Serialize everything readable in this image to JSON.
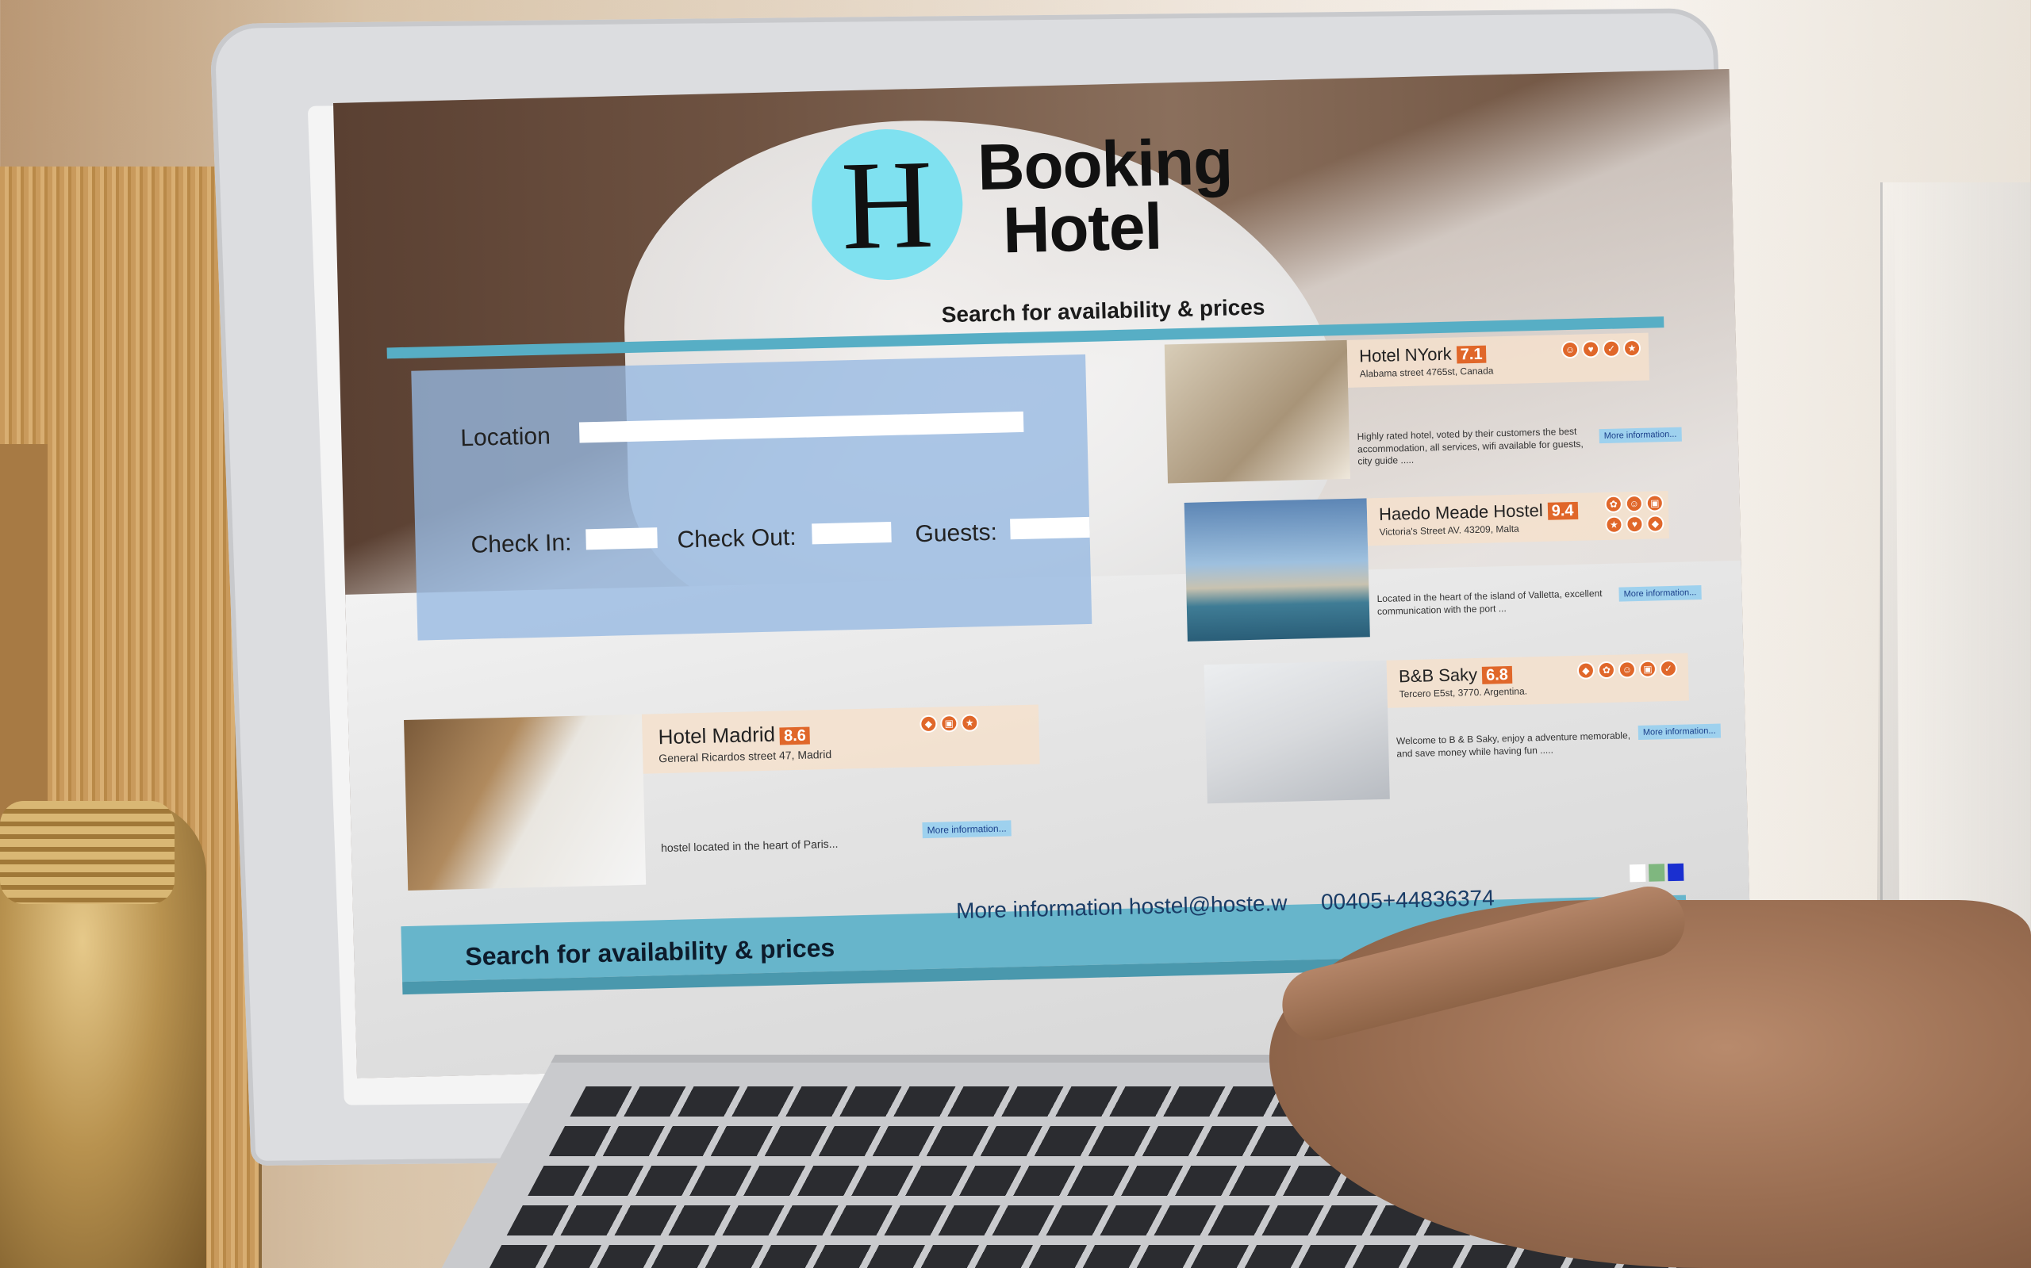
{
  "brand": {
    "logo_letter": "H",
    "name_line1": "Booking",
    "name_line2": "Hotel",
    "tagline": "Search for availability & prices"
  },
  "search": {
    "location_label": "Location",
    "checkin_label": "Check In:",
    "checkout_label": "Check Out:",
    "guests_label": "Guests:"
  },
  "hotels": [
    {
      "name": "Hotel NYork",
      "rating": "7.1",
      "address": "Alabama street 4765st, Canada",
      "description": "Highly rated hotel, voted by their customers the best accommodation, all services, wifi available for guests, city guide .....",
      "more": "More information...",
      "amenities": [
        "smile-icon",
        "heart-icon",
        "check-icon",
        "star-icon"
      ]
    },
    {
      "name": "Haedo Meade Hostel",
      "rating": "9.4",
      "address": "Victoria's Street AV. 43209, Malta",
      "description": "Located in the heart of the island of Valletta, excellent communication with the port ...",
      "more": "More information...",
      "amenities": [
        "paw-icon",
        "smile-icon",
        "tv-icon",
        "star-icon",
        "heart-icon",
        "shield-icon"
      ]
    },
    {
      "name": "B&B Saky",
      "rating": "6.8",
      "address": "Tercero E5st, 3770. Argentina.",
      "description": "Welcome to B & B Saky, enjoy a adventure memorable, and save money while having fun .....",
      "more": "More information...",
      "amenities": [
        "shield-icon",
        "paw-icon",
        "smile-icon",
        "tv-icon",
        "check-icon"
      ]
    },
    {
      "name": "Hotel Madrid",
      "rating": "8.6",
      "address": "General Ricardos street 47, Madrid",
      "description": "hostel located in the heart of Paris...",
      "more": "More information...",
      "amenities": [
        "shield-icon",
        "tv-icon",
        "star-icon"
      ]
    }
  ],
  "footer": {
    "tagline": "Search for availability & prices",
    "email": "More information hostel@hoste.w",
    "phone": "00405+44836374"
  },
  "colors": {
    "accent": "#57aec5",
    "logo": "#7fe1f0",
    "rating": "#e0672a",
    "panel": "#96b9e1",
    "swatches": [
      "#ffffff",
      "#7fb77f",
      "#1a2fd0"
    ]
  }
}
